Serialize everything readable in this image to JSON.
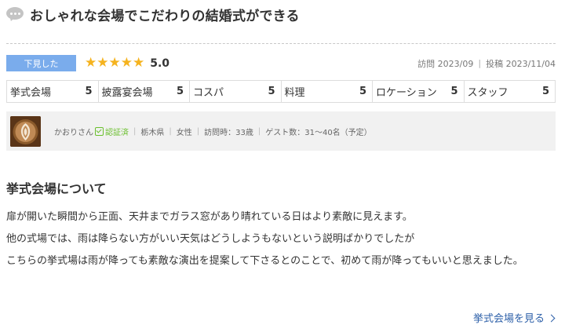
{
  "review": {
    "title": "おしゃれな会場でこだわりの結婚式ができる",
    "badge": "下見した",
    "stars": 5,
    "score": "5.0",
    "visit_date": "訪問 2023/09",
    "post_date": "投稿 2023/11/04",
    "date_separator": "|"
  },
  "ratings": [
    {
      "label": "挙式会場",
      "value": "5"
    },
    {
      "label": "披露宴会場",
      "value": "5"
    },
    {
      "label": "コスパ",
      "value": "5"
    },
    {
      "label": "料理",
      "value": "5"
    },
    {
      "label": "ロケーション",
      "value": "5"
    },
    {
      "label": "スタッフ",
      "value": "5"
    }
  ],
  "user": {
    "name": "かおりさん",
    "verified_label": "認証済",
    "prefecture": "栃木県",
    "gender": "女性",
    "visit_age": "訪問時：33歳",
    "guests": "ゲスト数：31～40名（予定）",
    "separator": "|"
  },
  "section": {
    "heading": "挙式会場について",
    "paragraphs": [
      "扉が開いた瞬間から正面、天井までガラス窓があり晴れている日はより素敵に見えます。",
      "他の式場では、雨は降らない方がいい天気はどうしようもないという説明ばかりでしたが",
      "こちらの挙式場は雨が降っても素敵な演出を提案して下さるとのことで、初めて雨が降ってもいいと思えました。"
    ],
    "link_label": "挙式会場を見る"
  },
  "colors": {
    "badge_bg": "#7aacec",
    "star": "#f5b31f",
    "verified": "#6abf2d",
    "link": "#2c5fa8"
  }
}
